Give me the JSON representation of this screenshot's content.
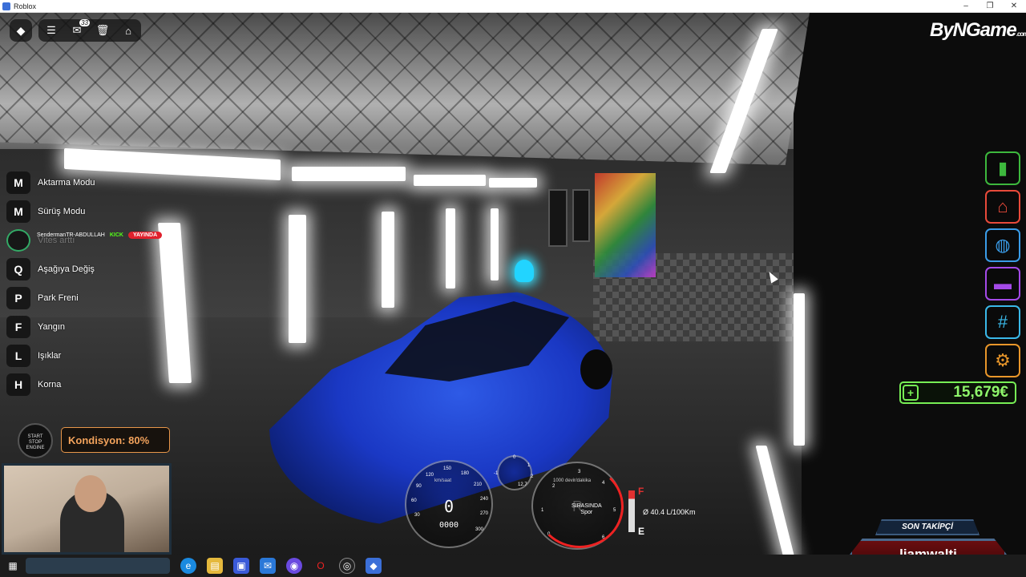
{
  "window": {
    "title": "Roblox",
    "controls": [
      "–",
      "❐",
      "✕"
    ]
  },
  "topbar": {
    "chat_badge": "33"
  },
  "brand_logo": {
    "text": "ByNGame",
    "suffix": ".com"
  },
  "key_hints": [
    {
      "key": "M",
      "label": "Aktarma Modu"
    },
    {
      "key": "M",
      "label": "Sürüş Modu"
    },
    {
      "key": "",
      "label": "Vites arttı"
    },
    {
      "key": "Q",
      "label": "Aşağıya Değiş"
    },
    {
      "key": "P",
      "label": "Park Freni"
    },
    {
      "key": "F",
      "label": "Yangın"
    },
    {
      "key": "L",
      "label": "Işıklar"
    },
    {
      "key": "H",
      "label": "Korna"
    }
  ],
  "ticker": {
    "user": "SendermanTR-ABDULLAH",
    "platform": "KICK",
    "status": "YAYINDA"
  },
  "engine_button": {
    "line1": "START",
    "line2": "STOP",
    "line3": "ENGINE"
  },
  "condition": {
    "text": "Kondisyon: 80%",
    "value_percent": 80
  },
  "side_menu": [
    {
      "name": "book-icon",
      "glyph": "▮",
      "color": "#3db83d"
    },
    {
      "name": "shop-icon",
      "glyph": "⌂",
      "color": "#e84a3a"
    },
    {
      "name": "backpack-icon",
      "glyph": "◍",
      "color": "#3a9ce8"
    },
    {
      "name": "folder-icon",
      "glyph": "▬",
      "color": "#a44ae8"
    },
    {
      "name": "hashtag-icon",
      "glyph": "#",
      "color": "#3ab8e8"
    },
    {
      "name": "settings-icon",
      "glyph": "⚙",
      "color": "#e8962a"
    }
  ],
  "money": {
    "plus": "+",
    "amount": "15,679€"
  },
  "dashboard": {
    "speed": "0",
    "odometer": "0000",
    "speed_unit": "km/saat",
    "rpm_unit": "1000 devir/dakika",
    "speed_ticks": [
      "30",
      "60",
      "90",
      "120",
      "150",
      "180",
      "210",
      "240",
      "270",
      "300"
    ],
    "rpm_ticks": [
      "1",
      "2",
      "3",
      "4",
      "5",
      "6",
      "0"
    ],
    "gear_mode_line1": "SIRASINDA",
    "gear_mode_line2": "Spor",
    "gear_letter": "R",
    "temp_ticks": [
      "-1",
      "0",
      "1",
      "2"
    ],
    "temp_center": "12.7",
    "consumption": "Ø 40.4 L/100Km",
    "fuel_full": "F",
    "fuel_empty": "E"
  },
  "follower": {
    "label": "SON TAKİPÇİ",
    "name": "liamwalti"
  }
}
